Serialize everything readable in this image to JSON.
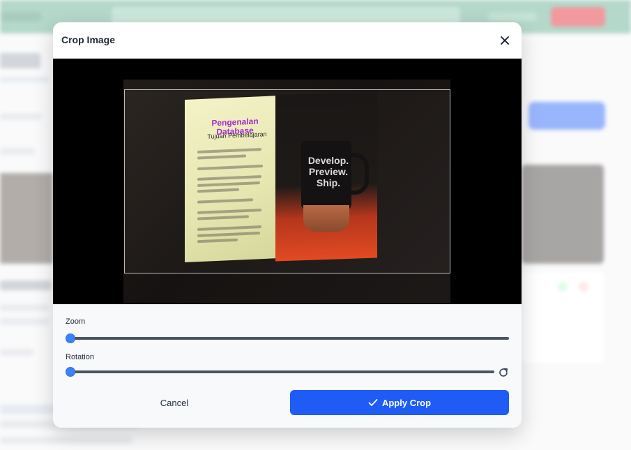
{
  "modal": {
    "title": "Crop Image",
    "close_icon": "close-icon"
  },
  "image": {
    "slide_title": "Pengenalan Database",
    "slide_subtitle": "Tujuan Pembelajaran",
    "mug_text": "Develop. Preview. Ship."
  },
  "controls": {
    "zoom_label": "Zoom",
    "zoom_value": 0,
    "rotation_label": "Rotation",
    "rotation_value": 0,
    "rotate_reset_icon": "rotate-reset-icon"
  },
  "actions": {
    "cancel_label": "Cancel",
    "apply_label": "Apply Crop",
    "apply_icon": "check-icon"
  },
  "colors": {
    "accent": "#1f5cf6",
    "thumb": "#3b82f6"
  }
}
